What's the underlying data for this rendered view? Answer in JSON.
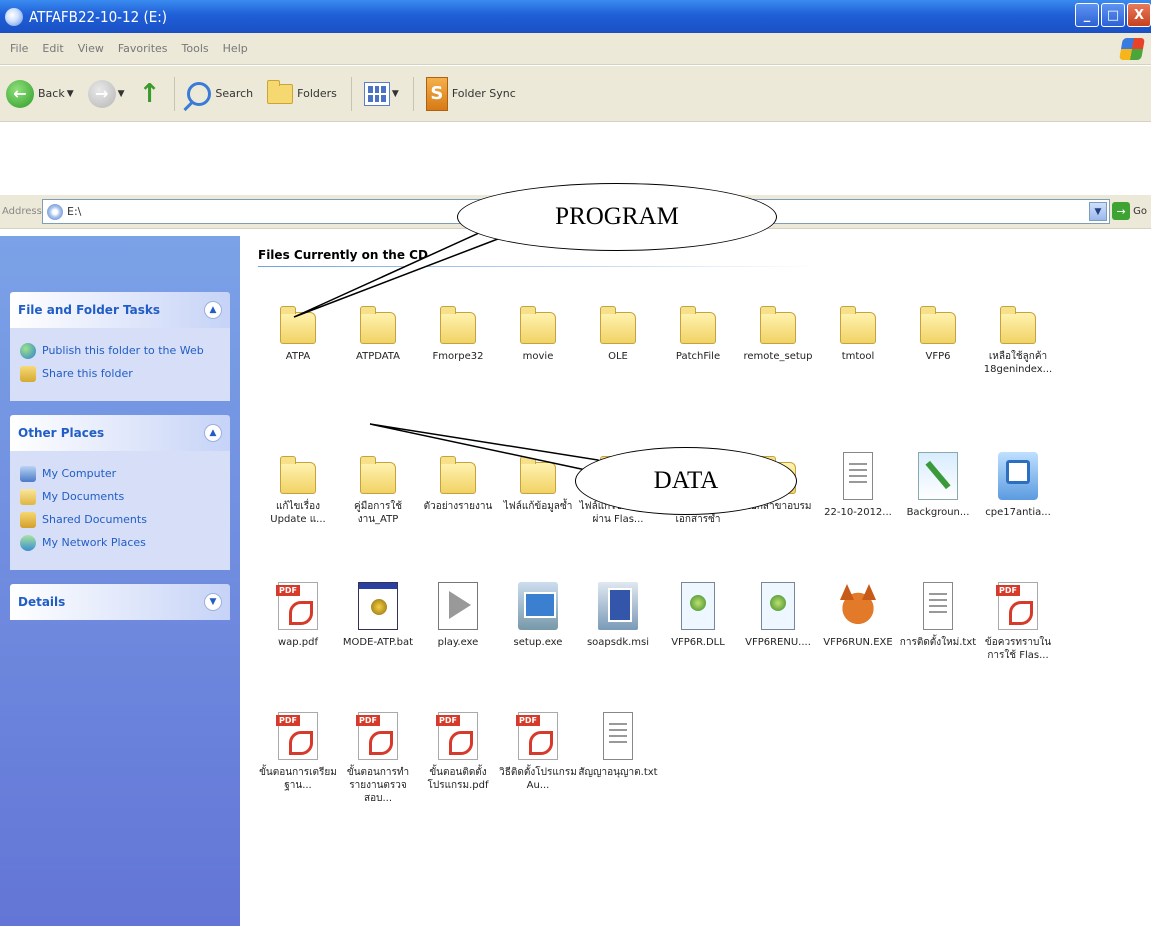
{
  "window": {
    "title": "ATFAFB22-10-12 (E:)",
    "buttons": [
      "_",
      "□",
      "X"
    ]
  },
  "menu": [
    "File",
    "Edit",
    "View",
    "Favorites",
    "Tools",
    "Help"
  ],
  "toolbar": {
    "back_label": "Back",
    "search_label": "Search",
    "folders_label": "Folders",
    "foldersync_label": "Folder Sync"
  },
  "address": {
    "label": "Address",
    "value": "E:\\",
    "go_label": "Go"
  },
  "sidebar": {
    "file_tasks": {
      "title": "File and Folder Tasks",
      "items": [
        "Publish this folder to the Web",
        "Share this folder"
      ]
    },
    "other_places": {
      "title": "Other Places",
      "items": [
        "My Computer",
        "My Documents",
        "Shared Documents",
        "My Network Places"
      ]
    },
    "details": {
      "title": "Details"
    }
  },
  "content": {
    "group_title": "Files Currently on the CD",
    "files": [
      {
        "name": "ATPA",
        "type": "folder"
      },
      {
        "name": "ATPDATA",
        "type": "folder"
      },
      {
        "name": "Fmorpe32",
        "type": "folder"
      },
      {
        "name": "movie",
        "type": "folder"
      },
      {
        "name": "OLE",
        "type": "folder"
      },
      {
        "name": "PatchFile",
        "type": "folder"
      },
      {
        "name": "remote_setup",
        "type": "folder"
      },
      {
        "name": "tmtool",
        "type": "folder"
      },
      {
        "name": "VFP6",
        "type": "folder"
      },
      {
        "name": "เหลือใช้ลูกค้า 18genindex...",
        "type": "folder"
      },
      {
        "name": "แก้ไขเรื่อง Update แ...",
        "type": "folder"
      },
      {
        "name": "คู่มือการใช้งาน_ATP",
        "type": "folder"
      },
      {
        "name": "ตัวอย่างรายงาน",
        "type": "folder"
      },
      {
        "name": "ไฟล์แก้ข้อมูลซ้ำ",
        "type": "folder"
      },
      {
        "name": "ไฟล์แก้ไขเคสที่ไม่ผ่าน Flas...",
        "type": "folder"
      },
      {
        "name": "รายงานตรวจสอบเอกสารซ้ำ",
        "type": "folder"
      },
      {
        "name": "แยกสาขาอบรม",
        "type": "folder"
      },
      {
        "name": "22-10-2012...",
        "type": "txt"
      },
      {
        "name": "Backgroun...",
        "type": "bmp"
      },
      {
        "name": "cpe17antia...",
        "type": "exe"
      },
      {
        "name": "wap.pdf",
        "type": "pdf"
      },
      {
        "name": "MODE-ATP.bat",
        "type": "bat"
      },
      {
        "name": "play.exe",
        "type": "play"
      },
      {
        "name": "setup.exe",
        "type": "setup"
      },
      {
        "name": "soapsdk.msi",
        "type": "msi"
      },
      {
        "name": "VFP6R.DLL",
        "type": "dll"
      },
      {
        "name": "VFP6RENU....",
        "type": "dll"
      },
      {
        "name": "VFP6RUN.EXE",
        "type": "fox"
      },
      {
        "name": "การติดตั้งใหม่.txt",
        "type": "txt"
      },
      {
        "name": "ข้อควรทราบในการใช้ Flas...",
        "type": "pdf"
      },
      {
        "name": "ขั้นตอนการเตรียมฐาน...",
        "type": "pdf"
      },
      {
        "name": "ขั้นตอนการทำรายงานตรวจสอบ...",
        "type": "pdf"
      },
      {
        "name": "ขั้นตอนติดตั้งโปรแกรม.pdf",
        "type": "pdf"
      },
      {
        "name": "วิธีติดตั้งโปรแกรม Au...",
        "type": "pdf"
      },
      {
        "name": "สัญญาอนุญาต.txt",
        "type": "txt"
      }
    ]
  },
  "annotations": {
    "program": "PROGRAM",
    "data": "DATA"
  }
}
